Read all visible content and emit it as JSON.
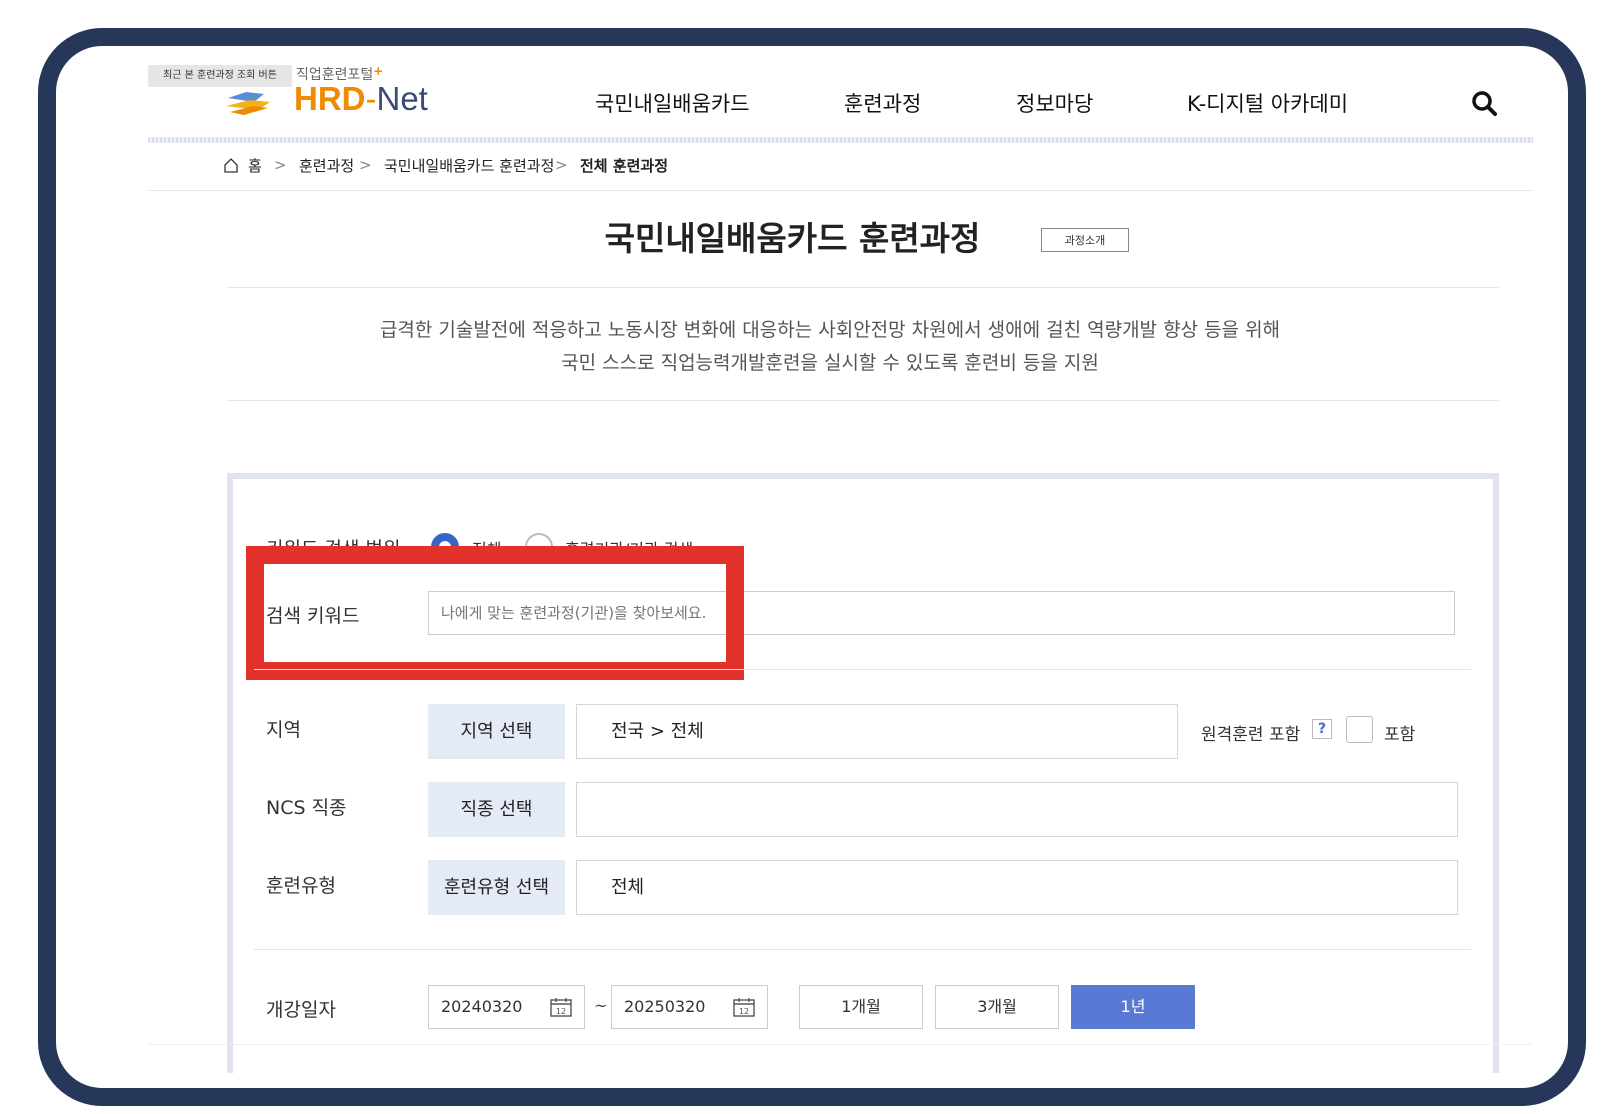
{
  "header": {
    "tooltip": "최근 본 훈련과정 조회 버튼",
    "tagline": "직업훈련포털",
    "tagline_plus": "+",
    "logo": {
      "part1": "HRD",
      "dash": "-",
      "part2": "Net"
    },
    "nav": [
      {
        "label": "국민내일배움카드"
      },
      {
        "label": "훈련과정"
      },
      {
        "label": "정보마당"
      },
      {
        "label": "K-디지털 아카데미"
      }
    ],
    "search_icon": "search-icon"
  },
  "breadcrumb": {
    "home_icon": "home-icon",
    "items": [
      "홈",
      "훈련과정",
      "국민내일배움카드 훈련과정",
      "전체 훈련과정"
    ],
    "separator": ">"
  },
  "page": {
    "title": "국민내일배움카드 훈련과정",
    "intro_button": "과정소개",
    "description": [
      "급격한 기술발전에 적응하고 노동시장 변화에 대응하는 사회안전망 차원에서 생애에 걸친 역량개발 향상 등을 위해",
      "국민 스스로 직업능력개발훈련을 실시할 수 있도록 훈련비 등을 지원"
    ]
  },
  "search": {
    "scope_label": "키워드 검색 범위",
    "scope_options": [
      "전체",
      "훈련기관/기관 검색"
    ],
    "keyword_label": "검색 키워드",
    "keyword_placeholder": "나에게 맞는 훈련과정(기관)을 찾아보세요.",
    "keyword_value": "",
    "region": {
      "label": "지역",
      "button": "지역 선택",
      "value": "전국 > 전체",
      "remote_label": "원격훈련 포함",
      "help": "?",
      "include_label": "포함",
      "include_checked": false
    },
    "ncs": {
      "label": "NCS 직종",
      "button": "직종 선택",
      "value": ""
    },
    "type": {
      "label": "훈련유형",
      "button": "훈련유형 선택",
      "value": "전체"
    },
    "date": {
      "label": "개강일자",
      "start": "20240320",
      "end": "20250320",
      "separator": "~",
      "calendar_day": "12",
      "periods": [
        "1개월",
        "3개월",
        "1년"
      ],
      "active_period": "1년"
    }
  },
  "colors": {
    "frame": "#26375a",
    "accent_orange": "#f08a00",
    "highlight_red": "#e3312b",
    "select_button_bg": "#e4ebf7",
    "active_period": "#5a79d4"
  }
}
